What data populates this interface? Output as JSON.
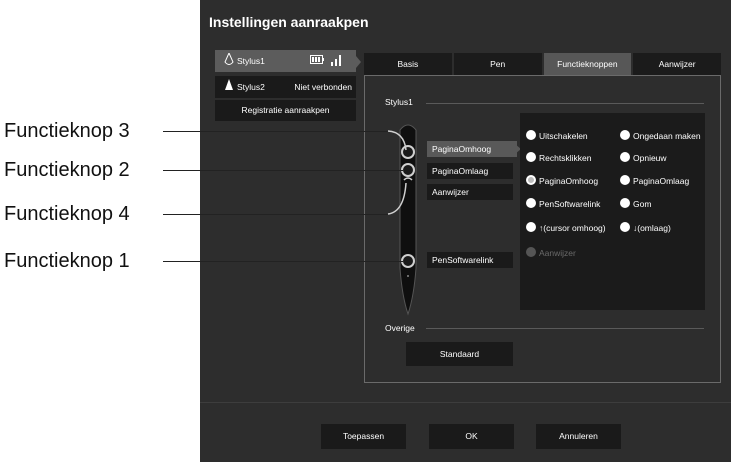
{
  "window": {
    "title": "Instellingen aanraakpen"
  },
  "styluses": [
    {
      "name": "Stylus1",
      "status": "",
      "icon": "pen-tip-icon"
    },
    {
      "name": "Stylus2",
      "status": "Niet verbonden",
      "icon": "pen-tip-icon"
    }
  ],
  "registration_button": "Registratie aanraakpen",
  "tabs": [
    {
      "label": "Basis",
      "active": false
    },
    {
      "label": "Pen",
      "active": false
    },
    {
      "label": "Functieknoppen",
      "active": true
    },
    {
      "label": "Aanwijzer",
      "active": false
    }
  ],
  "panel": {
    "section_stylus": "Stylus1",
    "section_other": "Overige",
    "function_buttons": [
      {
        "label": "PaginaOmhoog",
        "selected": true
      },
      {
        "label": "PaginaOmlaag",
        "selected": false
      },
      {
        "label": "Aanwijzer",
        "selected": false
      },
      {
        "label": "PenSoftwarelink",
        "selected": false
      }
    ],
    "options": [
      {
        "label": "Uitschakelen",
        "checked": false,
        "disabled": false
      },
      {
        "label": "Ongedaan maken",
        "checked": false,
        "disabled": false
      },
      {
        "label": "Rechtsklikken",
        "checked": false,
        "disabled": false
      },
      {
        "label": "Opnieuw",
        "checked": false,
        "disabled": false
      },
      {
        "label": "PaginaOmhoog",
        "checked": true,
        "disabled": false
      },
      {
        "label": "PaginaOmlaag",
        "checked": false,
        "disabled": false
      },
      {
        "label": "PenSoftwarelink",
        "checked": false,
        "disabled": false
      },
      {
        "label": "Gom",
        "checked": false,
        "disabled": false
      },
      {
        "label": "↑(cursor omhoog)",
        "checked": false,
        "disabled": false
      },
      {
        "label": "↓(omlaag)",
        "checked": false,
        "disabled": false
      },
      {
        "label": "Aanwijzer",
        "checked": false,
        "disabled": true
      }
    ],
    "default_button": "Standaard"
  },
  "footer": {
    "apply": "Toepassen",
    "ok": "OK",
    "cancel": "Annuleren"
  },
  "callouts": [
    "Functieknop 3",
    "Functieknop 2",
    "Functieknop 4",
    "Functieknop 1"
  ],
  "colors": {
    "window_bg": "#2d2d2d",
    "selected": "#5c5c5c",
    "button_bg": "#1a1a1a"
  }
}
